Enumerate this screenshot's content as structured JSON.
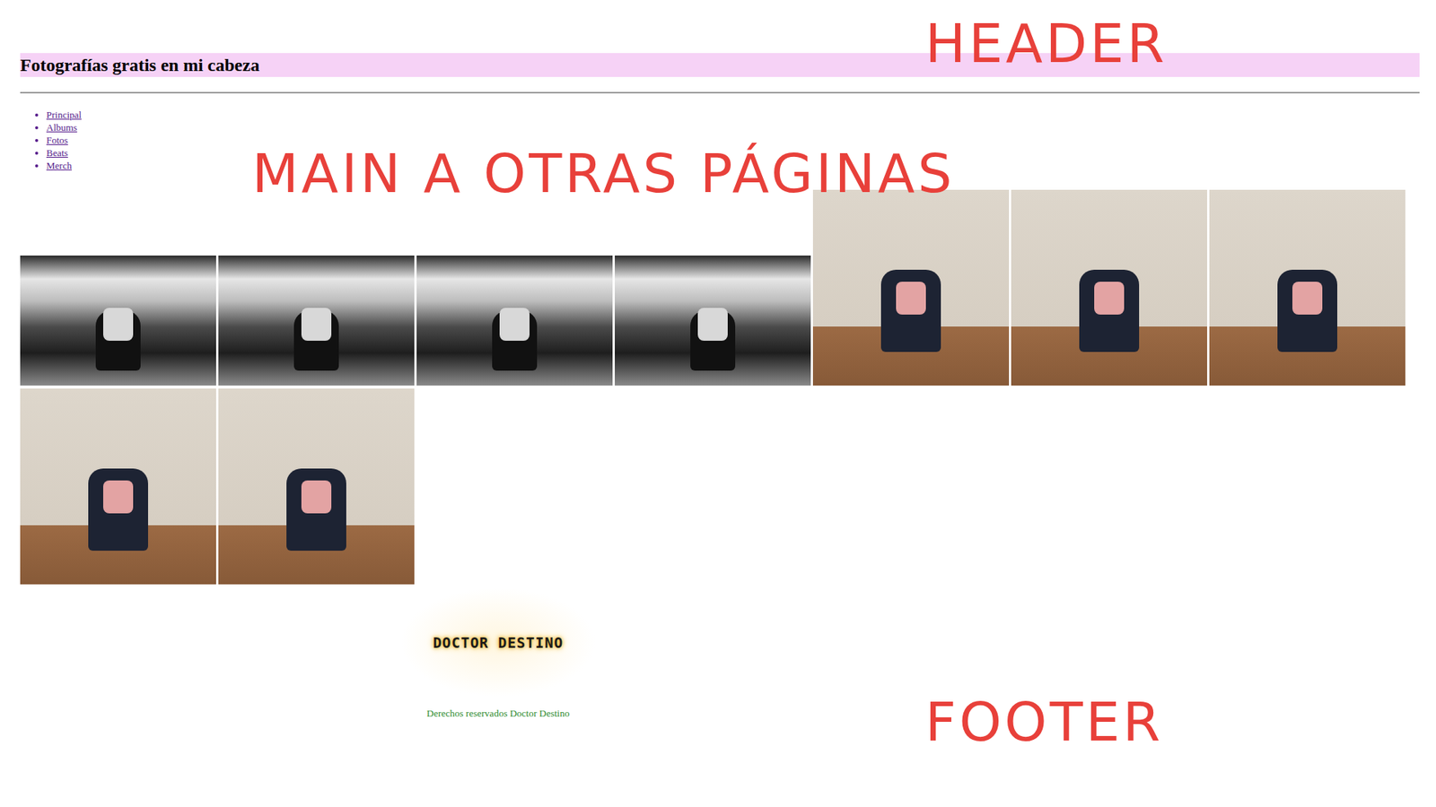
{
  "header": {
    "title": "Fotografías gratis en mi cabeza"
  },
  "nav": {
    "items": [
      {
        "label": "Principal"
      },
      {
        "label": "Albums"
      },
      {
        "label": "Fotos"
      },
      {
        "label": "Beats"
      },
      {
        "label": "Merch"
      }
    ]
  },
  "gallery": {
    "rows": [
      [
        {
          "kind": "bw"
        },
        {
          "kind": "bw"
        },
        {
          "kind": "bw"
        },
        {
          "kind": "bw"
        },
        {
          "kind": "color"
        },
        {
          "kind": "color"
        },
        {
          "kind": "color"
        }
      ],
      [
        {
          "kind": "color"
        },
        {
          "kind": "color"
        }
      ]
    ]
  },
  "footer": {
    "logo": "DOCTOR DESTINO",
    "copyright": "Derechos reservados Doctor Destino"
  },
  "annotations": [
    {
      "label": "HEADER",
      "kind": "header"
    },
    {
      "label": "MAIN A OTRAS PÁGINAS",
      "kind": "main"
    },
    {
      "label": "FOOTER",
      "kind": "footer"
    }
  ]
}
